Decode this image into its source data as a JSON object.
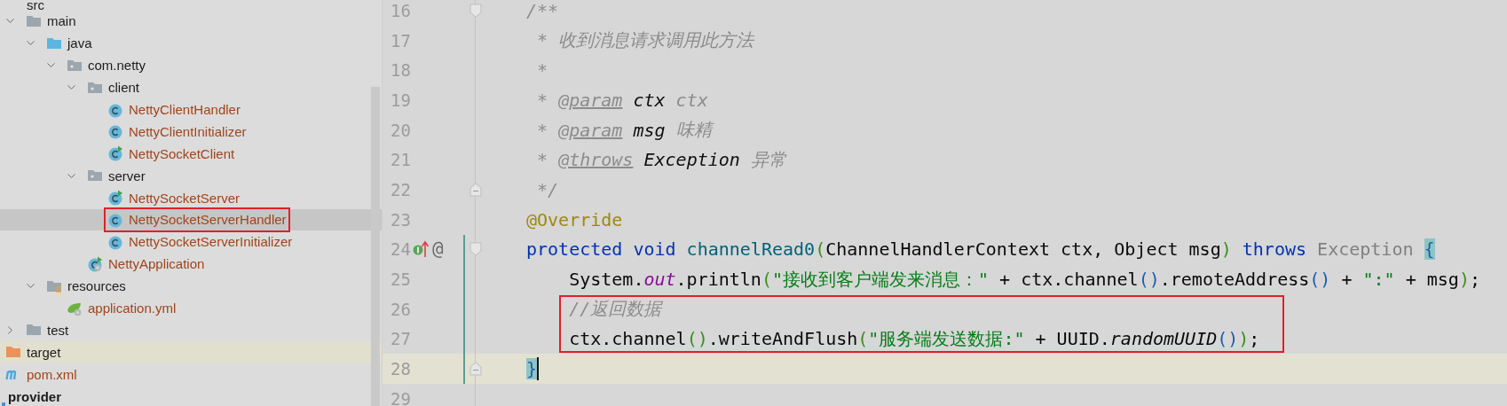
{
  "project_tree": {
    "items": [
      {
        "label": "src",
        "kind": "folder",
        "selected": false,
        "children": [
          {
            "label": "main",
            "kind": "folder",
            "expanded": true,
            "selected": false,
            "children": [
              {
                "label": "java",
                "kind": "source-folder",
                "expanded": true,
                "selected": false,
                "children": [
                  {
                    "label": "com.netty",
                    "kind": "package",
                    "expanded": true,
                    "selected": false,
                    "children": [
                      {
                        "label": "client",
                        "kind": "package",
                        "expanded": true,
                        "selected": false,
                        "children": [
                          {
                            "label": "NettyClientHandler",
                            "kind": "class",
                            "selected": false
                          },
                          {
                            "label": "NettyClientInitializer",
                            "kind": "class",
                            "selected": false
                          },
                          {
                            "label": "NettySocketClient",
                            "kind": "runnable-class",
                            "selected": false
                          }
                        ]
                      },
                      {
                        "label": "server",
                        "kind": "package",
                        "expanded": true,
                        "selected": false,
                        "children": [
                          {
                            "label": "NettySocketServer",
                            "kind": "runnable-class",
                            "selected": false
                          },
                          {
                            "label": "NettySocketServerHandler",
                            "kind": "class",
                            "selected": true,
                            "outlined": true
                          },
                          {
                            "label": "NettySocketServerInitializer",
                            "kind": "class",
                            "selected": false
                          }
                        ]
                      },
                      {
                        "label": "NettyApplication",
                        "kind": "spring-app",
                        "selected": false
                      }
                    ]
                  }
                ]
              },
              {
                "label": "resources",
                "kind": "resources-folder",
                "expanded": true,
                "selected": false,
                "children": [
                  {
                    "label": "application.yml",
                    "kind": "yml",
                    "selected": false
                  }
                ]
              }
            ]
          },
          {
            "label": "test",
            "kind": "folder",
            "expanded": false,
            "selected": false
          }
        ]
      },
      {
        "label": "target",
        "kind": "excluded-folder",
        "selected": false
      },
      {
        "label": "pom.xml",
        "kind": "maven",
        "selected": false
      },
      {
        "label": "provider",
        "kind": "module",
        "selected": false
      }
    ]
  },
  "editor": {
    "lines": [
      {
        "number": "16",
        "fold_start": true,
        "tokens": [
          {
            "text": "/**",
            "kind": "comment"
          }
        ]
      },
      {
        "number": "17",
        "tokens": [
          {
            "text": " * 收到消息请求调用此方法",
            "kind": "comment"
          }
        ]
      },
      {
        "number": "18",
        "tokens": [
          {
            "text": " *",
            "kind": "comment"
          }
        ]
      },
      {
        "number": "19",
        "tokens": [
          {
            "text": " * ",
            "kind": "comment"
          },
          {
            "text": "@param",
            "kind": "doc-tag"
          },
          {
            "text": " ctx",
            "kind": "doc-ref"
          },
          {
            "text": " ctx",
            "kind": "comment"
          }
        ]
      },
      {
        "number": "20",
        "tokens": [
          {
            "text": " * ",
            "kind": "comment"
          },
          {
            "text": "@param",
            "kind": "doc-tag"
          },
          {
            "text": " msg",
            "kind": "doc-ref"
          },
          {
            "text": " 味精",
            "kind": "comment"
          }
        ]
      },
      {
        "number": "21",
        "tokens": [
          {
            "text": " * ",
            "kind": "comment"
          },
          {
            "text": "@throws",
            "kind": "doc-tag"
          },
          {
            "text": " Exception",
            "kind": "doc-ref"
          },
          {
            "text": " 异常",
            "kind": "comment"
          }
        ]
      },
      {
        "number": "22",
        "fold_end": true,
        "tokens": [
          {
            "text": " */",
            "kind": "comment"
          }
        ]
      },
      {
        "number": "23",
        "tokens": [
          {
            "text": "@Override",
            "kind": "annotation"
          }
        ]
      },
      {
        "number": "24",
        "fold_start": true,
        "changed": true,
        "gutter": [
          {
            "kind": "implements"
          },
          {
            "kind": "annotation-marker",
            "glyph": "@"
          }
        ],
        "tokens": [
          {
            "text": "protected void",
            "kind": "keyword"
          },
          {
            "text": " channelRead0",
            "kind": "method"
          },
          {
            "text": "(",
            "kind": "paren-outer"
          },
          {
            "text": "ChannelHandlerContext ctx, Object msg",
            "kind": "plain"
          },
          {
            "text": ")",
            "kind": "paren-outer"
          },
          {
            "text": " throws",
            "kind": "keyword"
          },
          {
            "text": " Exception ",
            "kind": "unused"
          },
          {
            "text": "{",
            "kind": "brace-match"
          }
        ]
      },
      {
        "number": "25",
        "changed": true,
        "tokens": [
          {
            "text": "    System.",
            "kind": "plain"
          },
          {
            "text": "out",
            "kind": "static-field"
          },
          {
            "text": ".println",
            "kind": "plain"
          },
          {
            "text": "(",
            "kind": "paren-outer"
          },
          {
            "text": "\"接收到客户端发来消息：\"",
            "kind": "string"
          },
          {
            "text": " + ctx.channel",
            "kind": "plain"
          },
          {
            "text": "()",
            "kind": "paren-inner"
          },
          {
            "text": ".remoteAddress",
            "kind": "plain"
          },
          {
            "text": "()",
            "kind": "paren-inner"
          },
          {
            "text": " + ",
            "kind": "plain"
          },
          {
            "text": "\":\"",
            "kind": "string"
          },
          {
            "text": " + msg",
            "kind": "plain"
          },
          {
            "text": ")",
            "kind": "paren-outer"
          },
          {
            "text": ";",
            "kind": "plain"
          }
        ]
      },
      {
        "number": "26",
        "changed": true,
        "boxed": true,
        "tokens": [
          {
            "text": "    //返回数据",
            "kind": "comment"
          }
        ]
      },
      {
        "number": "27",
        "changed": true,
        "boxed": true,
        "tokens": [
          {
            "text": "    ctx.channel",
            "kind": "plain"
          },
          {
            "text": "()",
            "kind": "paren-outer"
          },
          {
            "text": ".writeAndFlush",
            "kind": "plain"
          },
          {
            "text": "(",
            "kind": "paren-outer"
          },
          {
            "text": "\"服务端发送数据:\"",
            "kind": "string"
          },
          {
            "text": " + UUID.",
            "kind": "plain"
          },
          {
            "text": "randomUUID",
            "kind": "static-method"
          },
          {
            "text": "()",
            "kind": "paren-inner"
          },
          {
            "text": ")",
            "kind": "paren-outer"
          },
          {
            "text": ";",
            "kind": "plain"
          }
        ]
      },
      {
        "number": "28",
        "fold_end": true,
        "changed": true,
        "current": true,
        "tokens": [
          {
            "text": "}",
            "kind": "brace-match"
          }
        ]
      },
      {
        "number": "29"
      }
    ]
  }
}
